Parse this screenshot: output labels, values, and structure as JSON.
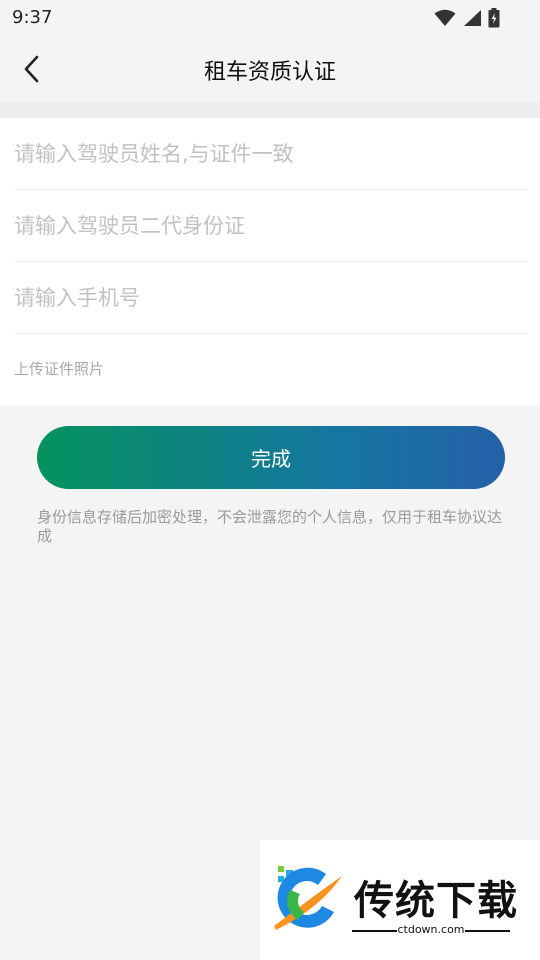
{
  "status_bar": {
    "time": "9:37",
    "icons": [
      "wifi-icon",
      "signal-icon",
      "battery-charging-icon"
    ]
  },
  "header": {
    "title": "租车资质认证",
    "back_icon": "chevron-left-icon"
  },
  "form": {
    "name_placeholder": "请输入驾驶员姓名,与证件一致",
    "id_placeholder": "请输入驾驶员二代身份证",
    "phone_placeholder": "请输入手机号",
    "upload_label": "上传证件照片"
  },
  "actions": {
    "done_label": "完成"
  },
  "privacy_note": "身份信息存储后加密处理，不会泄露您的个人信息，仅用于租车协议达成",
  "watermark": {
    "brand": "传统下载",
    "domain": "ctdown.com"
  },
  "colors": {
    "button_gradient_start": "#04925e",
    "button_gradient_end": "#2560a8",
    "background": "#f4f4f4"
  }
}
